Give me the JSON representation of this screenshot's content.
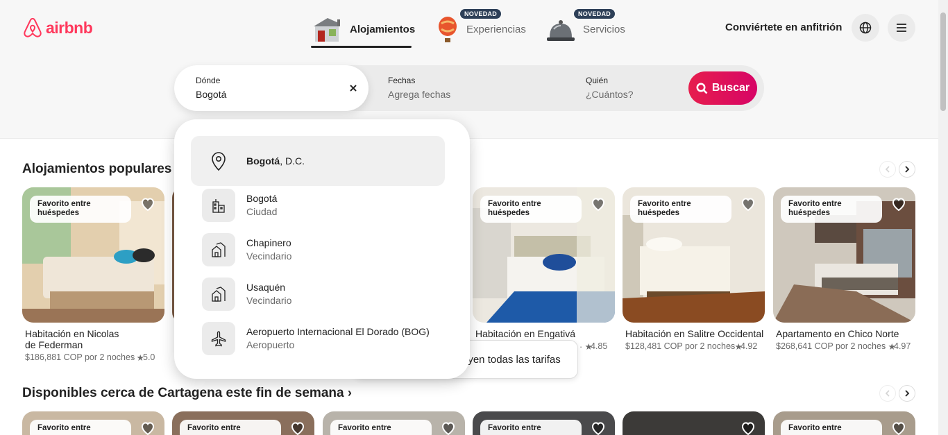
{
  "brand": {
    "name": "airbnb",
    "color": "#ff385c"
  },
  "nav": {
    "tabs": [
      {
        "label": "Alojamientos",
        "icon": "house-icon",
        "active": true
      },
      {
        "label": "Experiencias",
        "icon": "hot-air-balloon-icon",
        "badge": "NOVEDAD"
      },
      {
        "label": "Servicios",
        "icon": "service-bell-icon",
        "badge": "NOVEDAD"
      }
    ],
    "host_link": "Conviértete en anfitrión",
    "globe_icon": "globe-icon",
    "menu_icon": "menu-icon"
  },
  "search": {
    "where_label": "Dónde",
    "where_value": "Bogotá",
    "dates_label": "Fechas",
    "dates_placeholder": "Agrega fechas",
    "who_label": "Quién",
    "who_placeholder": "¿Cuántos?",
    "button_label": "Buscar"
  },
  "suggestions": [
    {
      "name_bold": "Bogotá",
      "name_rest": ", D.C.",
      "type": "",
      "icon": "location-pin-icon",
      "active": true
    },
    {
      "name": "Bogotá",
      "type": "Ciudad",
      "icon": "city-buildings-icon"
    },
    {
      "name": "Chapinero",
      "type": "Vecindario",
      "icon": "neighborhood-houses-icon"
    },
    {
      "name": "Usaquén",
      "type": "Vecindario",
      "icon": "neighborhood-houses-icon"
    },
    {
      "name": "Aeropuerto Internacional El Dorado (BOG)",
      "type": "Aeropuerto",
      "icon": "airplane-icon"
    }
  ],
  "sections": [
    {
      "title": "Alojamientos populares en"
    },
    {
      "title": "Disponibles cerca de Cartagena este fin de semana"
    }
  ],
  "badge_text": "Favorito entre huéspedes",
  "tariff_banner": "uyen todas las tarifas",
  "listings": [
    {
      "title_line1": "Habitación en Nicolas",
      "title_line2": "de Federman",
      "price": "$186,881 COP por 2 noches",
      "rating": "5.0",
      "colors": [
        "#e8d3b5",
        "#c7a07a",
        "#8a6a4a"
      ]
    },
    {
      "title_line1": "Habitación en Engativá",
      "price": "",
      "rating": "4.85",
      "colors": [
        "#e9e4da",
        "#2a4f8f",
        "#c8bfae"
      ]
    },
    {
      "title_line1": "Habitación en Salitre Occidental",
      "price": "$128,481 COP por 2 noches",
      "rating": "4.92",
      "colors": [
        "#f1ede4",
        "#d9cfba",
        "#7a4e2e"
      ]
    },
    {
      "title_line1": "Apartamento en Chico Norte",
      "price": "$268,641 COP por 2 noches",
      "rating": "4.97",
      "colors": [
        "#d8d2c8",
        "#6d5a4a",
        "#3c3a38"
      ]
    }
  ],
  "row2_cards": [
    {
      "badge": "Favorito entre"
    },
    {
      "badge": "Favorito entre"
    },
    {
      "badge": "Favorito entre"
    },
    {
      "badge": "Favorito entre"
    },
    {
      "badge": ""
    },
    {
      "badge": "Favorito entre"
    }
  ]
}
